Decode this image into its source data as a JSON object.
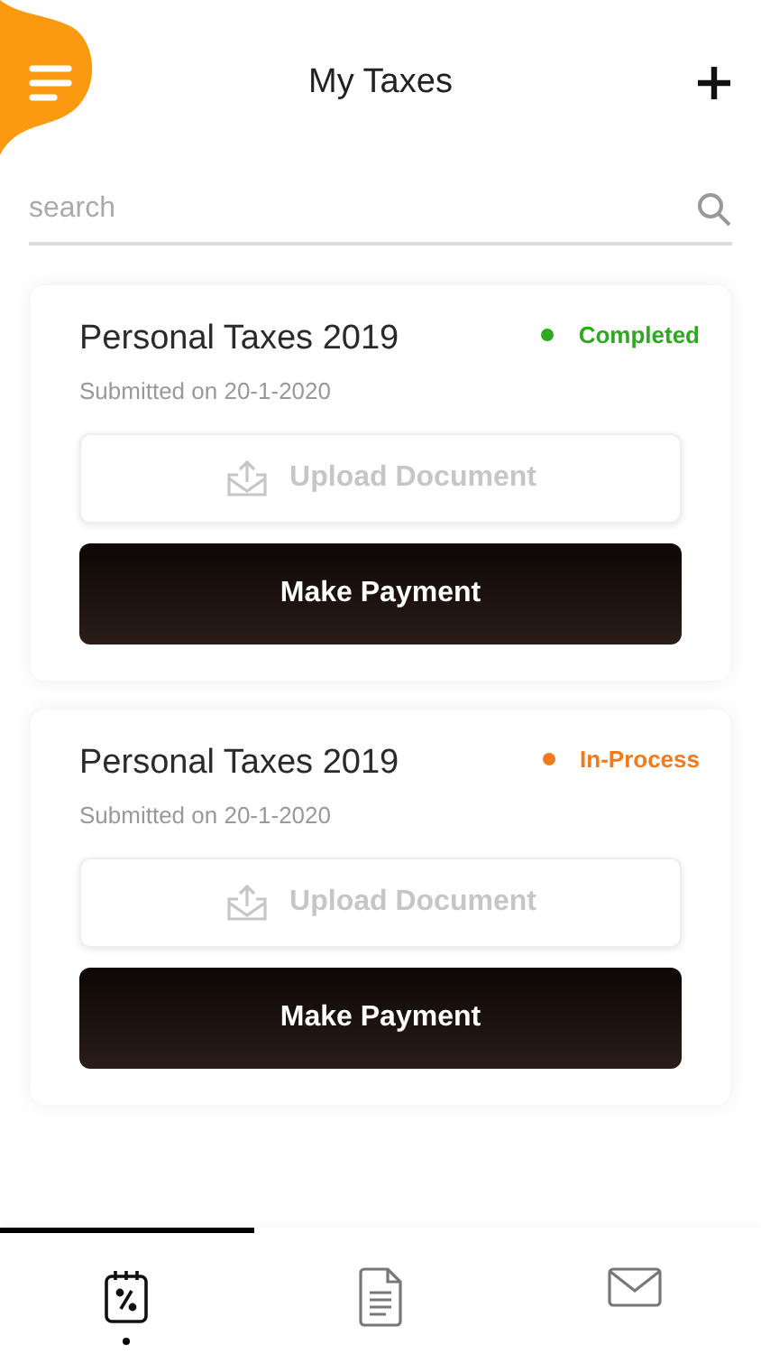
{
  "header": {
    "title": "My Taxes"
  },
  "search": {
    "placeholder": "search"
  },
  "cards": [
    {
      "title": "Personal Taxes 2019",
      "subtitle": "Submitted on 20-1-2020",
      "status": "Completed",
      "color": "#2ea81e",
      "upload_label": "Upload Document",
      "payment_label": "Make Payment"
    },
    {
      "title": "Personal Taxes 2019",
      "subtitle": "Submitted on 20-1-2020",
      "status": "In-Process",
      "color": "#f07a1e",
      "upload_label": "Upload Document",
      "payment_label": "Make Payment"
    }
  ],
  "tabs": [
    {
      "kind": "taxes",
      "selected": true
    },
    {
      "kind": "documents",
      "selected": false
    },
    {
      "kind": "messages",
      "selected": false
    }
  ]
}
